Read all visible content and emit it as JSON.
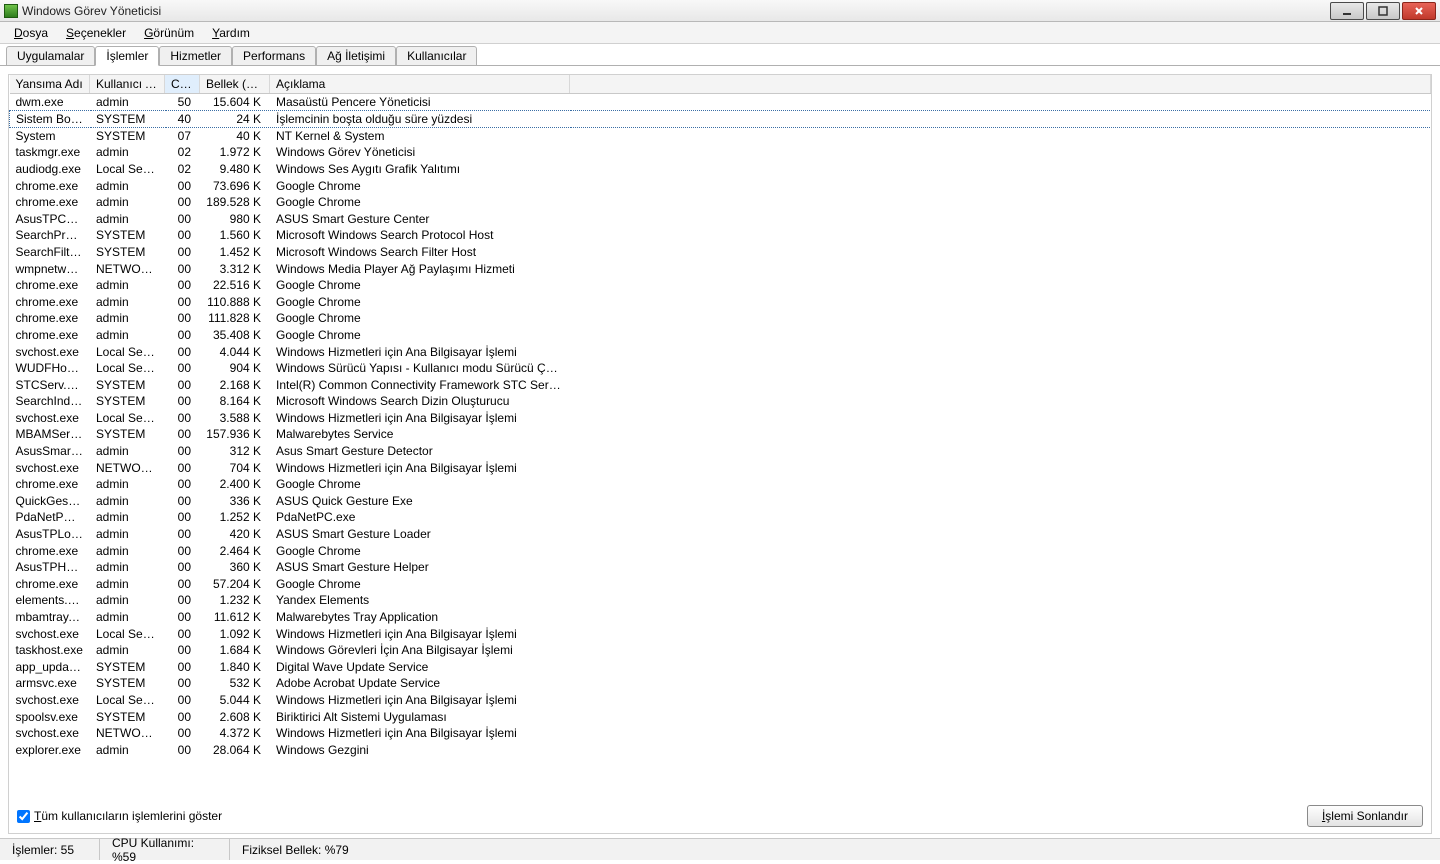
{
  "window": {
    "title": "Windows Görev Yöneticisi"
  },
  "menubar": [
    {
      "label": "Dosya",
      "ukey": "D"
    },
    {
      "label": "Seçenekler",
      "ukey": "S"
    },
    {
      "label": "Görünüm",
      "ukey": "G"
    },
    {
      "label": "Yardım",
      "ukey": "Y"
    }
  ],
  "tabs": [
    {
      "label": "Uygulamalar",
      "active": false
    },
    {
      "label": "İşlemler",
      "active": true
    },
    {
      "label": "Hizmetler",
      "active": false
    },
    {
      "label": "Performans",
      "active": false
    },
    {
      "label": "Ağ İletişimi",
      "active": false
    },
    {
      "label": "Kullanıcılar",
      "active": false
    }
  ],
  "columns": {
    "image_name": "Yansıma Adı",
    "user_name": "Kullanıcı Adı",
    "cpu": "CPU",
    "memory": "Bellek (Öz...",
    "description": "Açıklama"
  },
  "processes": [
    {
      "name": "dwm.exe",
      "user": "admin",
      "cpu": "50",
      "mem": "15.604 K",
      "desc": "Masaüstü Pencere Yöneticisi"
    },
    {
      "name": "Sistem Boşta...",
      "user": "SYSTEM",
      "cpu": "40",
      "mem": "24 K",
      "desc": "İşlemcinin boşta olduğu süre yüzdesi",
      "selected": true
    },
    {
      "name": "System",
      "user": "SYSTEM",
      "cpu": "07",
      "mem": "40 K",
      "desc": "NT Kernel & System"
    },
    {
      "name": "taskmgr.exe",
      "user": "admin",
      "cpu": "02",
      "mem": "1.972 K",
      "desc": "Windows Görev Yöneticisi"
    },
    {
      "name": "audiodg.exe",
      "user": "Local Serv...",
      "cpu": "02",
      "mem": "9.480 K",
      "desc": "Windows Ses Aygıtı Grafik Yalıtımı"
    },
    {
      "name": "chrome.exe",
      "user": "admin",
      "cpu": "00",
      "mem": "73.696 K",
      "desc": "Google Chrome"
    },
    {
      "name": "chrome.exe",
      "user": "admin",
      "cpu": "00",
      "mem": "189.528 K",
      "desc": "Google Chrome"
    },
    {
      "name": "AsusTPCent...",
      "user": "admin",
      "cpu": "00",
      "mem": "980 K",
      "desc": "ASUS Smart Gesture Center"
    },
    {
      "name": "SearchProto...",
      "user": "SYSTEM",
      "cpu": "00",
      "mem": "1.560 K",
      "desc": "Microsoft Windows Search Protocol Host"
    },
    {
      "name": "SearchFilter...",
      "user": "SYSTEM",
      "cpu": "00",
      "mem": "1.452 K",
      "desc": "Microsoft Windows Search Filter Host"
    },
    {
      "name": "wmpnetwk.exe",
      "user": "NETWOR...",
      "cpu": "00",
      "mem": "3.312 K",
      "desc": "Windows Media Player Ağ Paylaşımı Hizmeti"
    },
    {
      "name": "chrome.exe",
      "user": "admin",
      "cpu": "00",
      "mem": "22.516 K",
      "desc": "Google Chrome"
    },
    {
      "name": "chrome.exe",
      "user": "admin",
      "cpu": "00",
      "mem": "110.888 K",
      "desc": "Google Chrome"
    },
    {
      "name": "chrome.exe",
      "user": "admin",
      "cpu": "00",
      "mem": "111.828 K",
      "desc": "Google Chrome"
    },
    {
      "name": "chrome.exe",
      "user": "admin",
      "cpu": "00",
      "mem": "35.408 K",
      "desc": "Google Chrome"
    },
    {
      "name": "svchost.exe",
      "user": "Local Serv...",
      "cpu": "00",
      "mem": "4.044 K",
      "desc": "Windows Hizmetleri için Ana Bilgisayar İşlemi"
    },
    {
      "name": "WUDFHost....",
      "user": "Local Serv...",
      "cpu": "00",
      "mem": "904 K",
      "desc": "Windows Sürücü Yapısı - Kullanıcı modu Sürücü Çerç..."
    },
    {
      "name": "STCServ.exe",
      "user": "SYSTEM",
      "cpu": "00",
      "mem": "2.168 K",
      "desc": "Intel(R) Common Connectivity Framework STC Service"
    },
    {
      "name": "SearchIndex...",
      "user": "SYSTEM",
      "cpu": "00",
      "mem": "8.164 K",
      "desc": "Microsoft Windows Search Dizin Oluşturucu"
    },
    {
      "name": "svchost.exe",
      "user": "Local Serv...",
      "cpu": "00",
      "mem": "3.588 K",
      "desc": "Windows Hizmetleri için Ana Bilgisayar İşlemi"
    },
    {
      "name": "MBAMServic...",
      "user": "SYSTEM",
      "cpu": "00",
      "mem": "157.936 K",
      "desc": "Malwarebytes Service"
    },
    {
      "name": "AsusSmartG...",
      "user": "admin",
      "cpu": "00",
      "mem": "312 K",
      "desc": "Asus Smart Gesture Detector"
    },
    {
      "name": "svchost.exe",
      "user": "NETWOR...",
      "cpu": "00",
      "mem": "704 K",
      "desc": "Windows Hizmetleri için Ana Bilgisayar İşlemi"
    },
    {
      "name": "chrome.exe",
      "user": "admin",
      "cpu": "00",
      "mem": "2.400 K",
      "desc": "Google Chrome"
    },
    {
      "name": "QuickGestur...",
      "user": "admin",
      "cpu": "00",
      "mem": "336 K",
      "desc": "ASUS Quick Gesture Exe"
    },
    {
      "name": "PdaNetPC.exe",
      "user": "admin",
      "cpu": "00",
      "mem": "1.252 K",
      "desc": "PdaNetPC.exe"
    },
    {
      "name": "AsusTPLoad...",
      "user": "admin",
      "cpu": "00",
      "mem": "420 K",
      "desc": "ASUS Smart Gesture Loader"
    },
    {
      "name": "chrome.exe",
      "user": "admin",
      "cpu": "00",
      "mem": "2.464 K",
      "desc": "Google Chrome"
    },
    {
      "name": "AsusTPHelp...",
      "user": "admin",
      "cpu": "00",
      "mem": "360 K",
      "desc": "ASUS Smart Gesture Helper"
    },
    {
      "name": "chrome.exe",
      "user": "admin",
      "cpu": "00",
      "mem": "57.204 K",
      "desc": "Google Chrome"
    },
    {
      "name": "elements.exe",
      "user": "admin",
      "cpu": "00",
      "mem": "1.232 K",
      "desc": "Yandex Elements"
    },
    {
      "name": "mbamtray.exe",
      "user": "admin",
      "cpu": "00",
      "mem": "11.612 K",
      "desc": "Malwarebytes Tray Application"
    },
    {
      "name": "svchost.exe",
      "user": "Local Serv...",
      "cpu": "00",
      "mem": "1.092 K",
      "desc": "Windows Hizmetleri için Ana Bilgisayar İşlemi"
    },
    {
      "name": "taskhost.exe",
      "user": "admin",
      "cpu": "00",
      "mem": "1.684 K",
      "desc": "Windows Görevleri İçin Ana Bilgisayar İşlemi"
    },
    {
      "name": "app_update...",
      "user": "SYSTEM",
      "cpu": "00",
      "mem": "1.840 K",
      "desc": "Digital Wave Update Service"
    },
    {
      "name": "armsvc.exe",
      "user": "SYSTEM",
      "cpu": "00",
      "mem": "532 K",
      "desc": "Adobe Acrobat Update Service"
    },
    {
      "name": "svchost.exe",
      "user": "Local Serv...",
      "cpu": "00",
      "mem": "5.044 K",
      "desc": "Windows Hizmetleri için Ana Bilgisayar İşlemi"
    },
    {
      "name": "spoolsv.exe",
      "user": "SYSTEM",
      "cpu": "00",
      "mem": "2.608 K",
      "desc": "Biriktirici Alt Sistemi Uygulaması"
    },
    {
      "name": "svchost.exe",
      "user": "NETWOR...",
      "cpu": "00",
      "mem": "4.372 K",
      "desc": "Windows Hizmetleri için Ana Bilgisayar İşlemi"
    },
    {
      "name": "explorer.exe",
      "user": "admin",
      "cpu": "00",
      "mem": "28.064 K",
      "desc": "Windows Gezgini"
    }
  ],
  "bottom": {
    "show_all_users": "Tüm kullanıcıların işlemlerini göster",
    "show_all_users_checked": true,
    "end_process": "İşlemi Sonlandır"
  },
  "status": {
    "processes_label": "İşlemler: 55",
    "cpu_label": "CPU Kullanımı: %59",
    "mem_label": "Fiziksel Bellek: %79"
  }
}
